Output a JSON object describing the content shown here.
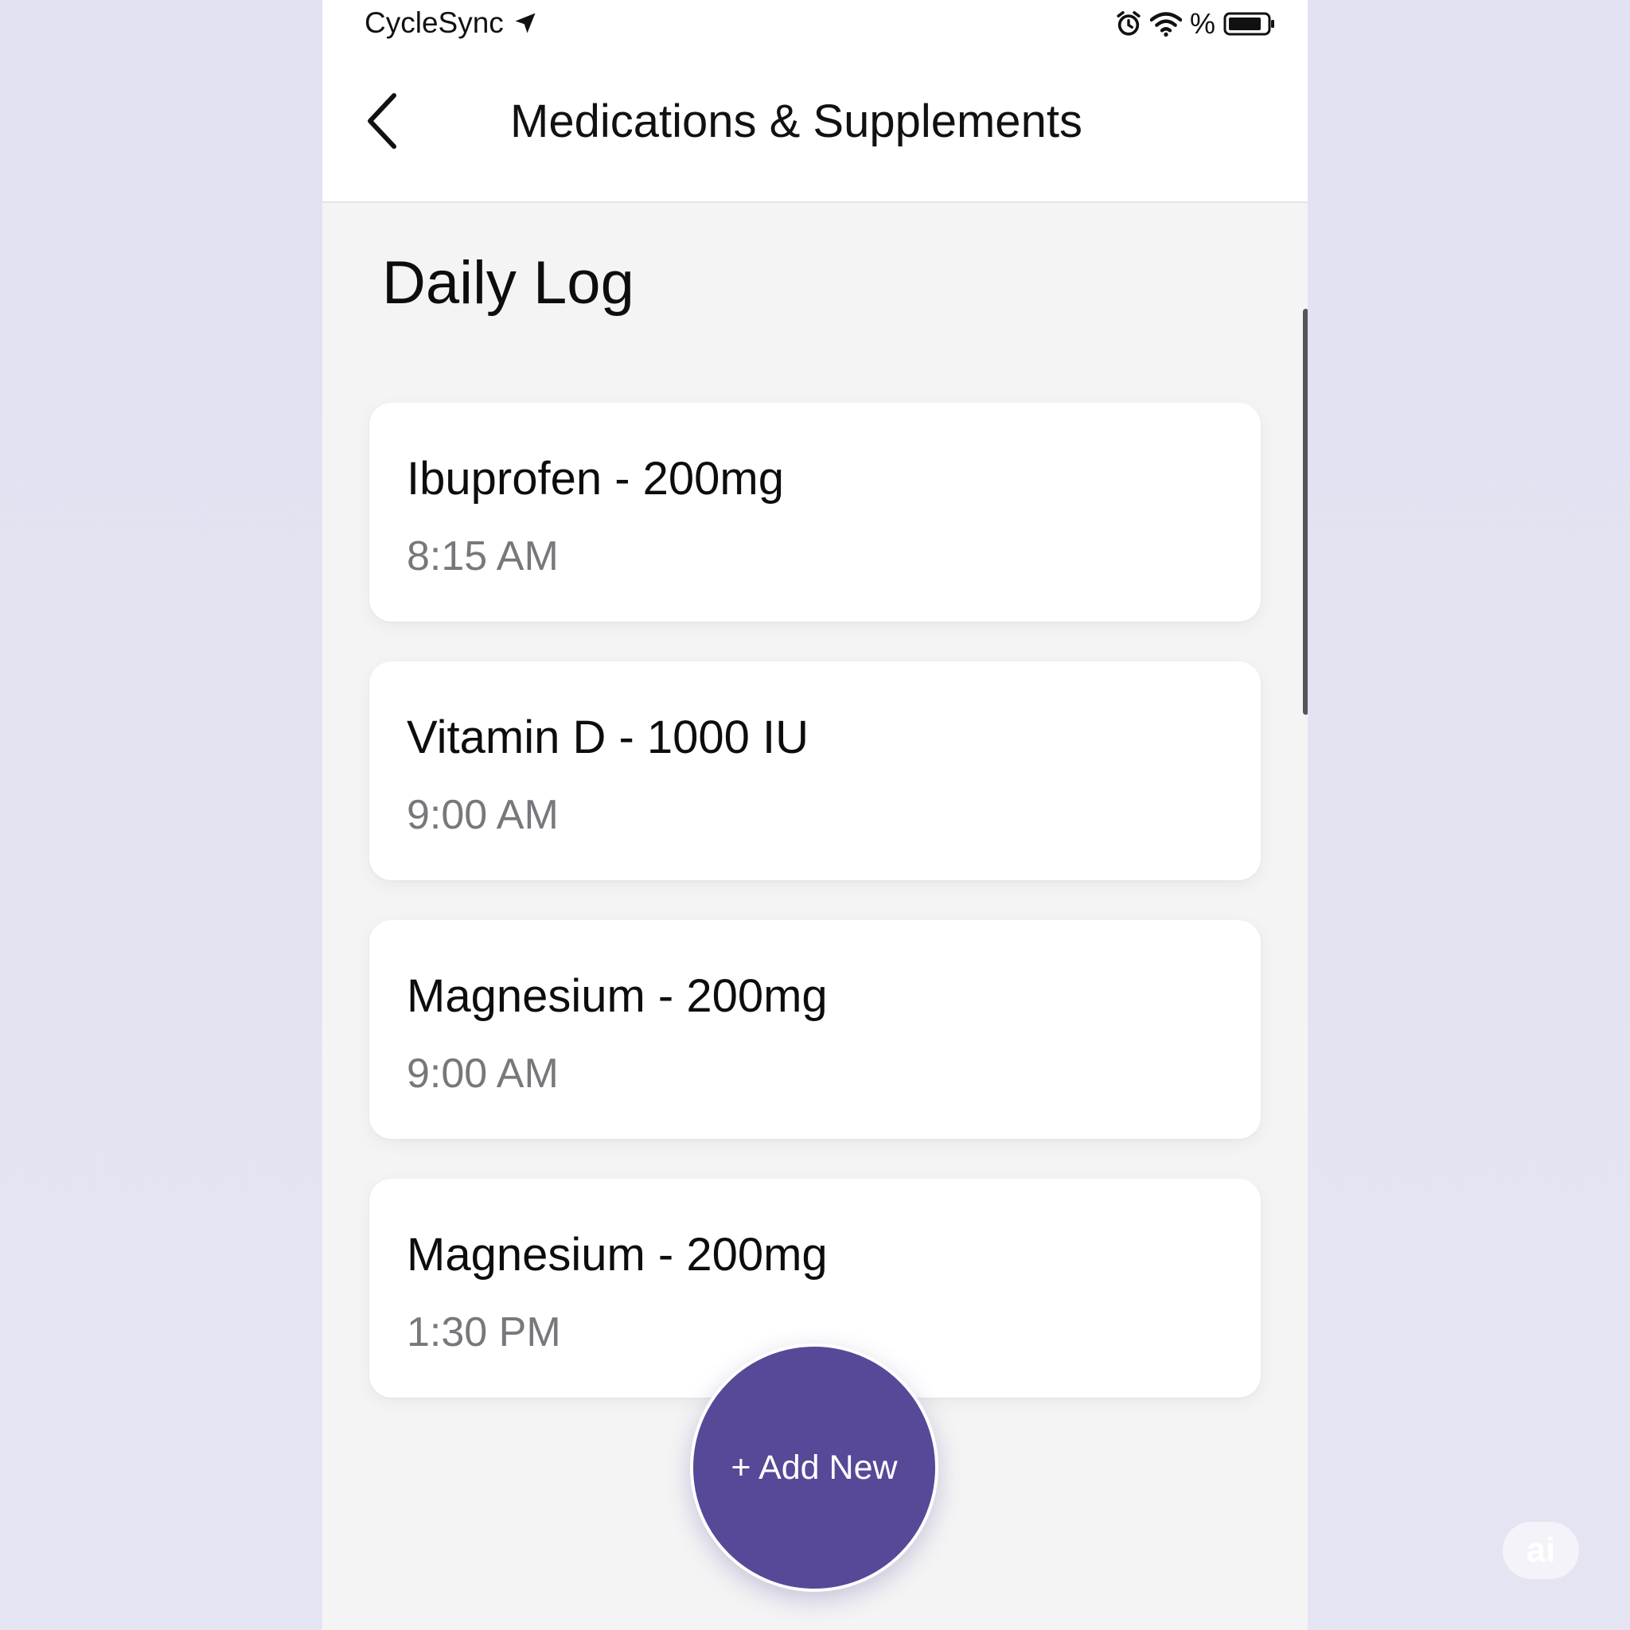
{
  "status_bar": {
    "carrier": "CycleSync",
    "battery_symbol": "%",
    "icons": [
      "location-arrow-icon",
      "alarm-clock-icon",
      "wifi-icon",
      "battery-icon"
    ]
  },
  "nav": {
    "title": "Medications & Supplements",
    "back_icon": "chevron-left-icon"
  },
  "section": {
    "title": "Daily Log"
  },
  "entries": [
    {
      "name": "Ibuprofen - 200mg",
      "time": "8:15 AM"
    },
    {
      "name": "Vitamin D - 1000 IU",
      "time": "9:00 AM"
    },
    {
      "name": "Magnesium - 200mg",
      "time": "9:00 AM"
    },
    {
      "name": "Magnesium - 200mg",
      "time": "1:30 PM"
    }
  ],
  "fab": {
    "label": "+ Add New"
  },
  "watermark": {
    "text": "ai"
  },
  "colors": {
    "accent": "#574898",
    "background_outer": "#e3e3f2",
    "card_background": "#ffffff",
    "secondary_text": "#77777c"
  }
}
